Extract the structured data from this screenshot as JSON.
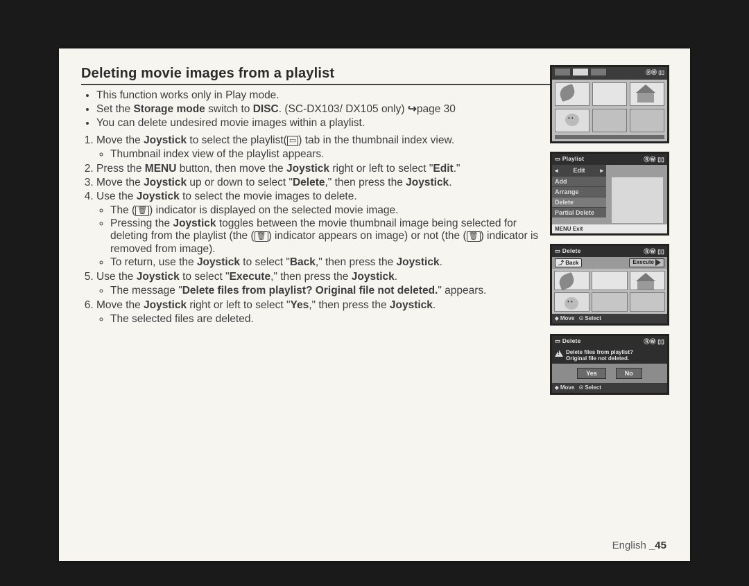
{
  "heading": "Deleting movie images from a playlist",
  "intro": [
    "This function works only in Play mode.",
    "Set the <b>Storage mode</b> switch to <b>DISC</b>. (SC-DX103/ DX105 only) <arrow>↪</arrow>page 30",
    "You can delete undesired movie images within a playlist."
  ],
  "steps": [
    {
      "text": "Move the <b>Joystick</b> to select the playlist(<glyph>▭</glyph>) tab in the thumbnail index view.",
      "sub": [
        "Thumbnail index view of the playlist appears."
      ]
    },
    {
      "text": "Press the <b>MENU</b> button, then move the <b>Joystick</b> right or left to select \"<b>Edit</b>.\""
    },
    {
      "text": "Move the <b>Joystick</b> up or down to select \"<b>Delete</b>,\" then press the <b>Joystick</b>."
    },
    {
      "text": "Use the <b>Joystick</b> to select the movie images to delete.",
      "sub": [
        "The (<glyph>🗑</glyph>) indicator is displayed on the selected movie image.",
        "Pressing the <b>Joystick</b> toggles between the movie thumbnail image being selected for deleting from the playlist (the (<glyph>🗑</glyph>) indicator appears on image) or not (the (<glyph>🗑</glyph>) indicator is removed from image).",
        "To return, use the <b>Joystick</b> to select \"<b>Back</b>,\" then press the <b>Joystick</b>."
      ]
    },
    {
      "text": "Use the <b>Joystick</b> to select \"<b>Execute</b>,\" then press the <b>Joystick</b>.",
      "sub": [
        "The message \"<b>Delete files from playlist? Original file not deleted.</b>\" appears."
      ]
    },
    {
      "text": "Move the <b>Joystick</b> right or left to select \"<b>Yes</b>,\" then press the <b>Joystick</b>.",
      "sub": [
        "The selected files are deleted."
      ]
    }
  ],
  "screen1": {
    "badge_right": "ⓇⓌ ▯▯"
  },
  "screen2": {
    "title_left": "▭  Playlist",
    "title_right": "ⓇⓌ ▯▯",
    "tab": "Edit",
    "items": [
      "Add",
      "Arrange",
      "Delete",
      "Partial Delete"
    ],
    "foot": "MENU  Exit"
  },
  "screen3": {
    "title_left": "▭  Delete",
    "title_right": "ⓇⓌ ▯▯",
    "back": "⤴ Back",
    "execute": "Execute",
    "foot_left": "⬥ Move",
    "foot_right": "⊙ Select"
  },
  "screen4": {
    "title_left": "▭  Delete",
    "title_right": "ⓇⓌ ▯▯",
    "warn1": "Delete files from playlist?",
    "warn2": "Original file not deleted.",
    "yes": "Yes",
    "no": "No",
    "foot_left": "⬥ Move",
    "foot_right": "⊙ Select"
  },
  "footer": {
    "lang": "English ",
    "page": "_45"
  }
}
